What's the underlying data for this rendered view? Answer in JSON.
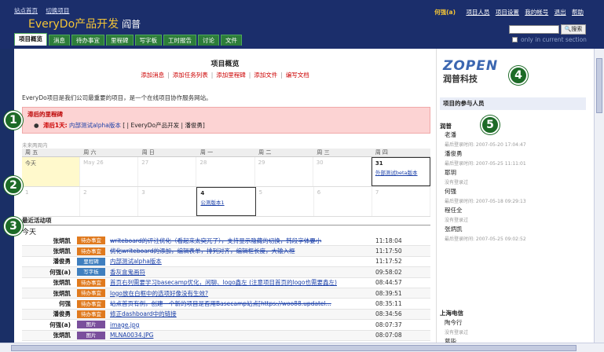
{
  "header": {
    "top_links": [
      "站点首页",
      "切换项目"
    ],
    "app_title": "EveryDo产品开发",
    "app_user": "阎普",
    "user_name": "何强(a)",
    "user_links": [
      "项目人员",
      "项目设置",
      "我的帐号",
      "退出",
      "帮助"
    ],
    "search_button": "搜索",
    "only_in_section": "only in current section"
  },
  "tabs": [
    {
      "label": "项目概览",
      "active": true
    },
    {
      "label": "消息",
      "active": false
    },
    {
      "label": "待办事宜",
      "active": false
    },
    {
      "label": "里程碑",
      "active": false
    },
    {
      "label": "写字板",
      "active": false
    },
    {
      "label": "工时报告",
      "active": false
    },
    {
      "label": "讨论",
      "active": false
    },
    {
      "label": "文件",
      "active": false
    }
  ],
  "main": {
    "title": "项目概览",
    "actions": [
      "添加消息",
      "添加任务列表",
      "添加里程碑",
      "添加文件",
      "编写文档"
    ],
    "description": "EveryDo项目是我们公司最重要的项目，是一个在线项目协作服务网站。",
    "late_title": "滞后的里程碑",
    "late_days": "滞后1天:",
    "late_link": "内部测试alpha版本",
    "late_rest": "[ | EveryDo产品开发 | 潘俊勇]",
    "calendar_caption": "未来两周内",
    "calendar_head": [
      "周 五",
      "周 六",
      "周 日",
      "周 一",
      "周 二",
      "周 三",
      "周 四"
    ],
    "calendar_week1": [
      {
        "num": "今天",
        "today": true,
        "ev": ""
      },
      {
        "num": "May 26",
        "ev": ""
      },
      {
        "num": "27",
        "ev": ""
      },
      {
        "num": "28",
        "ev": ""
      },
      {
        "num": "29",
        "ev": ""
      },
      {
        "num": "30",
        "ev": ""
      },
      {
        "num": "31",
        "dark": true,
        "boxed": true,
        "ev": "外部测试beta版本"
      }
    ],
    "calendar_week2": [
      {
        "num": "1",
        "ev": ""
      },
      {
        "num": "2",
        "ev": ""
      },
      {
        "num": "3",
        "ev": ""
      },
      {
        "num": "4",
        "dark": true,
        "boxed": true,
        "ev": "公测版本1"
      },
      {
        "num": "5",
        "ev": ""
      },
      {
        "num": "6",
        "ev": ""
      },
      {
        "num": "7",
        "ev": ""
      }
    ],
    "recent_title": "最近活动项",
    "recent_today": "今天",
    "activities": [
      {
        "who": "张炳凯",
        "badge": "待办事宜",
        "badge_color": "#e07a1e",
        "msg": "writeboard的评注优化（看起来太突兀了），支持显示隐藏的切换，韩段字体要小",
        "done": true,
        "time": "11:18:04"
      },
      {
        "who": "张炳凯",
        "badge": "待办事宜",
        "badge_color": "#e07a1e",
        "msg": "优化writeboard的添加，编辑表单，排列对齐，编辑框长度，大输入框",
        "done": true,
        "time": "11:17:50"
      },
      {
        "who": "潘俊勇",
        "badge": "里程碑",
        "badge_color": "#3f7fbf",
        "msg": "内部测试alpha版本",
        "done": false,
        "time": "11:17:52"
      },
      {
        "who": "何强(a)",
        "badge": "写字板",
        "badge_color": "#3f7fbf",
        "msg": "香灰盒鬼画符",
        "done": false,
        "time": "09:58:02"
      },
      {
        "who": "张炳凯",
        "badge": "待办事宜",
        "badge_color": "#e07a1e",
        "msg": "首页右列需要学习basecamp优化，闲聊、logo鑫左 (注意项目首页的logo也需要鑫左)",
        "done": false,
        "time": "08:44:57"
      },
      {
        "who": "张炳凯",
        "badge": "待办事宜",
        "badge_color": "#e07a1e",
        "msg": "logo放在白框中的选项好像没有生效?",
        "done": false,
        "time": "08:39:51"
      },
      {
        "who": "何强",
        "badge": "待办事宜",
        "badge_color": "#e07a1e",
        "msg": "站点首页有例，创建一个新的项目是否用Basecamp站点[https://woo88.updatel...",
        "done": true,
        "time": "08:35:11"
      },
      {
        "who": "潘俊勇",
        "badge": "待办事宜",
        "badge_color": "#e07a1e",
        "msg": "修正dashboard中的链接",
        "done": false,
        "time": "08:34:56"
      },
      {
        "who": "何强(a)",
        "badge": "图片",
        "badge_color": "#7a4f9c",
        "msg": "image.jpg",
        "done": false,
        "time": "08:07:37"
      },
      {
        "who": "张炳凯",
        "badge": "图片",
        "badge_color": "#7a4f9c",
        "msg": "MLNA0034.JPG",
        "done": false,
        "time": "08:07:08"
      }
    ]
  },
  "side": {
    "logo_text": "ZOPEN",
    "logo_cn": "润普科技",
    "participants_title": "项目的参与人员",
    "org1": "润普",
    "org2": "上海电信",
    "members1": [
      {
        "name": "老潘",
        "sub": "最后登录时间: 2007-05-20 17:04:47"
      },
      {
        "name": "潘俊勇",
        "sub": "最后登录时间: 2007-05-25 11:11:01"
      },
      {
        "name": "耶玥",
        "sub": "没有登录过"
      },
      {
        "name": "何强",
        "sub": "最后登录时间: 2007-05-18 09:29:13"
      },
      {
        "name": "程任全",
        "sub": "没有登录过"
      },
      {
        "name": "张炳凯",
        "sub": "最后登录时间: 2007-05-25 09:02:52"
      }
    ],
    "members2": [
      {
        "name": "陶今行",
        "sub": "没有登录过"
      },
      {
        "name": "葛毕",
        "sub": "没有登录过"
      }
    ]
  },
  "markers": [
    "1",
    "2",
    "3",
    "4",
    "5"
  ]
}
